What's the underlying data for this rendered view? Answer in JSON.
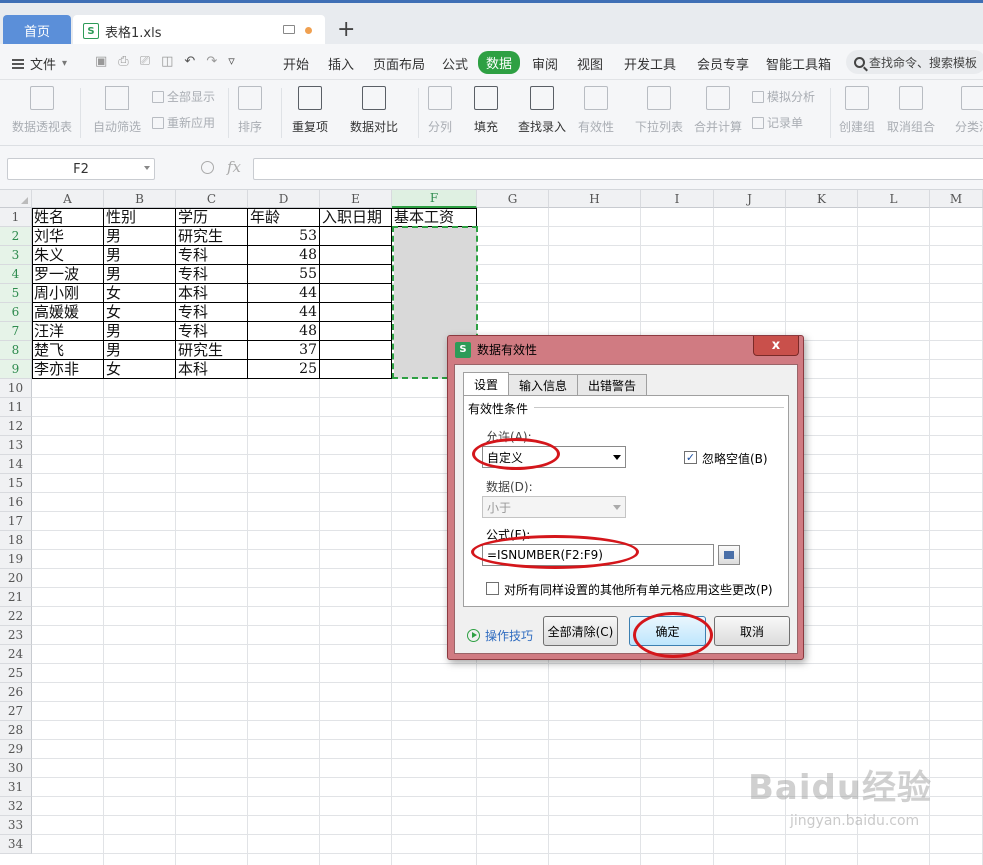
{
  "tabbar": {
    "home": "首页",
    "file_name": "表格1.xls",
    "file_icon": "S",
    "new_tab": "+"
  },
  "menubar": {
    "file_menu": "文件",
    "items": [
      "开始",
      "插入",
      "页面布局",
      "公式",
      "数据",
      "审阅",
      "视图",
      "开发工具",
      "会员专享",
      "智能工具箱"
    ],
    "active": "数据",
    "search_placeholder": "查找命令、搜索模板"
  },
  "ribbon": {
    "pivot": "数据透视表",
    "autofilter": "自动筛选",
    "show_all": "全部显示",
    "reapply": "重新应用",
    "sort": "排序",
    "duplicates": "重复项",
    "compare": "数据对比",
    "split": "分列",
    "fill": "填充",
    "lookup": "查找录入",
    "validity": "有效性",
    "dropdown": "下拉列表",
    "consolidate": "合并计算",
    "simulate": "模拟分析",
    "record": "记录单",
    "group": "创建组",
    "ungroup": "取消组合",
    "subtotal": "分类汇"
  },
  "formula_bar": {
    "cell_ref": "F2",
    "fx": "fx",
    "value": ""
  },
  "sheet": {
    "columns": [
      "A",
      "B",
      "C",
      "D",
      "E",
      "F",
      "G",
      "H",
      "I",
      "J",
      "K",
      "L",
      "M"
    ],
    "selected_column": "F",
    "rows": [
      "1",
      "2",
      "3",
      "4",
      "5",
      "6",
      "7",
      "8",
      "9",
      "10",
      "11",
      "12",
      "13",
      "14",
      "15",
      "16",
      "17",
      "18",
      "19",
      "20",
      "21",
      "22",
      "23",
      "24",
      "25",
      "26",
      "27",
      "28",
      "29",
      "30",
      "31",
      "32",
      "33",
      "34"
    ],
    "header": [
      "姓名",
      "性别",
      "学历",
      "年龄",
      "入职日期",
      "基本工资"
    ],
    "data": [
      [
        "刘华",
        "男",
        "研究生",
        "53"
      ],
      [
        "朱义",
        "男",
        "专科",
        "48"
      ],
      [
        "罗一波",
        "男",
        "专科",
        "55"
      ],
      [
        "周小刚",
        "女",
        "本科",
        "44"
      ],
      [
        "高媛媛",
        "女",
        "专科",
        "44"
      ],
      [
        "汪洋",
        "男",
        "专科",
        "48"
      ],
      [
        "楚飞",
        "男",
        "研究生",
        "37"
      ],
      [
        "李亦非",
        "女",
        "本科",
        "25"
      ]
    ]
  },
  "dialog": {
    "title": "数据有效性",
    "close": "x",
    "tabs": [
      "设置",
      "输入信息",
      "出错警告"
    ],
    "group_title": "有效性条件",
    "allow_label": "允许(A):",
    "allow_value": "自定义",
    "ignore_blank": "忽略空值(B)",
    "ignore_blank_checked": "✓",
    "data_label": "数据(D):",
    "data_value": "小于",
    "formula_label": "公式(F):",
    "formula_value": "=ISNUMBER(F2:F9)",
    "apply_all": "对所有同样设置的其他所有单元格应用这些更改(P)",
    "tips": "操作技巧",
    "clear_all": "全部清除(C)",
    "ok": "确定",
    "cancel": "取消"
  },
  "watermark": {
    "brand": "Baidu经验",
    "url": "jingyan.baidu.com"
  },
  "colors": {
    "accent_green": "#2ea043",
    "annotation_red": "#d4161b",
    "dialog_frame": "#d07b82"
  }
}
